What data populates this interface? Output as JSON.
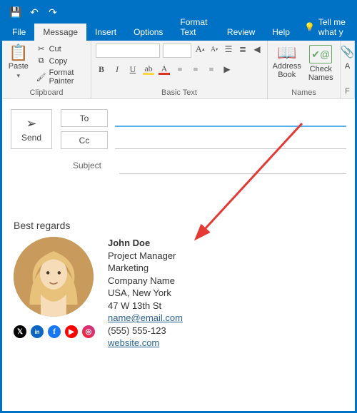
{
  "titlebar": {
    "save_icon": "💾",
    "undo_icon": "↶",
    "redo_icon": "↷"
  },
  "tabs": {
    "file": "File",
    "message": "Message",
    "insert": "Insert",
    "options": "Options",
    "format_text": "Format Text",
    "review": "Review",
    "help": "Help",
    "tellme": "Tell me what y"
  },
  "ribbon": {
    "paste": "Paste",
    "cut": "Cut",
    "copy": "Copy",
    "format_painter": "Format Painter",
    "clipboard_group": "Clipboard",
    "b": "B",
    "i": "I",
    "u": "U",
    "a": "A",
    "basic_text_group": "Basic Text",
    "address_book": "Address Book",
    "check_names": "Check Names",
    "names_group": "Names",
    "attach": "A",
    "f": "F"
  },
  "compose": {
    "send": "Send",
    "to": "To",
    "cc": "Cc",
    "subject": "Subject"
  },
  "signature": {
    "best_regards": "Best regards",
    "name": "John Doe",
    "title": "Project Manager",
    "department": "Marketing",
    "company": "Company Name",
    "location": "USA, New York",
    "street": "47 W 13th St",
    "email": "name@email.com",
    "phone": "(555) 555-123",
    "website": "website.com"
  },
  "socials": {
    "x": "𝕏",
    "in": "in",
    "fb": "f",
    "yt": "▶",
    "ig": "◎"
  }
}
